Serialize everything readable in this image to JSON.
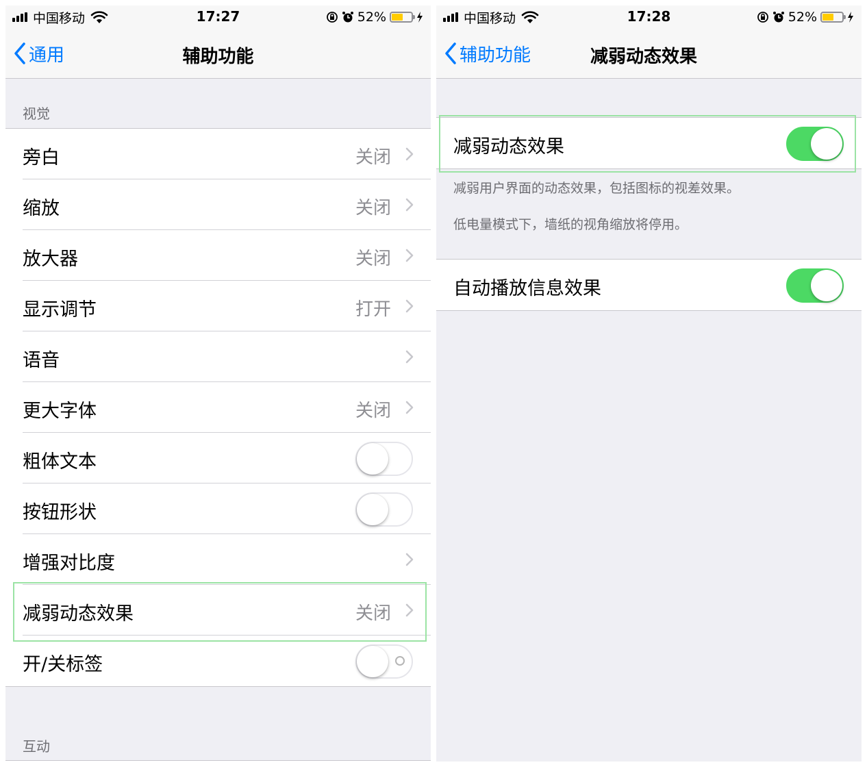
{
  "left": {
    "status": {
      "carrier": "中国移动",
      "time": "17:27",
      "battery_percent": "52%",
      "battery_level": 0.52
    },
    "nav": {
      "back_label": "通用",
      "title": "辅助功能"
    },
    "vision_header": "视觉",
    "rows": [
      {
        "label": "旁白",
        "value": "关闭"
      },
      {
        "label": "缩放",
        "value": "关闭"
      },
      {
        "label": "放大器",
        "value": "关闭"
      },
      {
        "label": "显示调节",
        "value": "打开"
      },
      {
        "label": "语音",
        "value": ""
      },
      {
        "label": "更大字体",
        "value": "关闭"
      },
      {
        "label": "粗体文本",
        "toggle": false
      },
      {
        "label": "按钮形状",
        "toggle": false
      },
      {
        "label": "增强对比度",
        "value": ""
      },
      {
        "label": "减弱动态效果",
        "value": "关闭"
      },
      {
        "label": "开/关标签",
        "toggle": false
      }
    ],
    "interaction_header": "互动"
  },
  "right": {
    "status": {
      "carrier": "中国移动",
      "time": "17:28",
      "battery_percent": "52%",
      "battery_level": 0.52
    },
    "nav": {
      "back_label": "辅助功能",
      "title": "减弱动态效果"
    },
    "reduce_motion": {
      "label": "减弱动态效果",
      "toggle": true
    },
    "footer_line1": "减弱用户界面的动态效果，包括图标的视差效果。",
    "footer_line2": "低电量模式下，墙纸的视角缩放将停用。",
    "auto_play": {
      "label": "自动播放信息效果",
      "toggle": true
    }
  },
  "colors": {
    "accent": "#007aff",
    "toggle_on": "#4cd964",
    "highlight": "#9be3a4",
    "battery": "#ffcc00"
  }
}
